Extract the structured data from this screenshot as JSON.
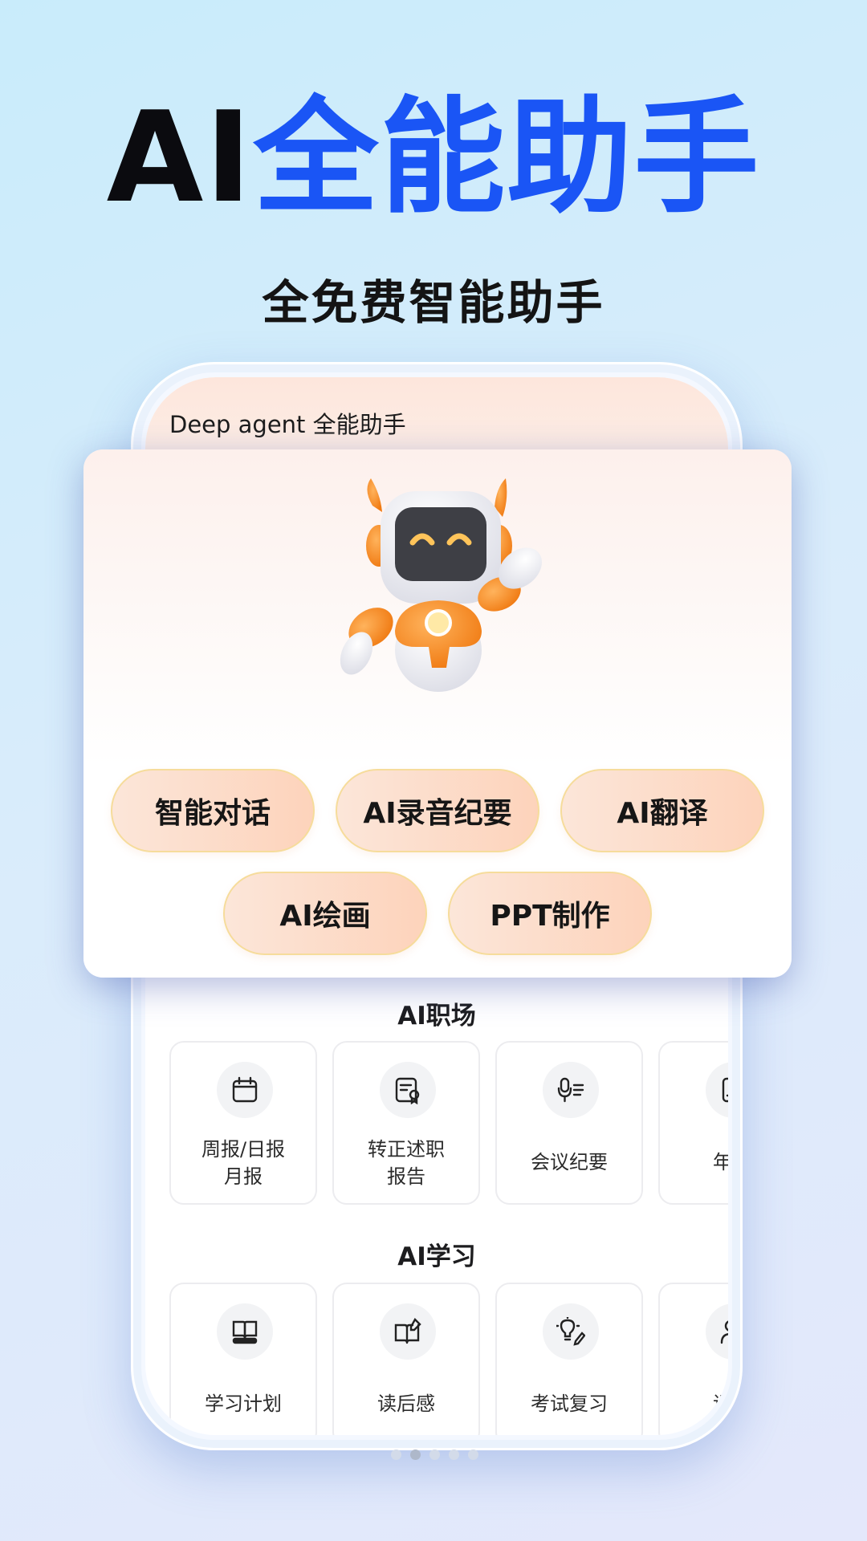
{
  "hero": {
    "title_prefix": "AI",
    "title_main": "全能助手",
    "subtitle": "全免费智能助手"
  },
  "app": {
    "title": "Deep agent 全能助手"
  },
  "features": {
    "row1": [
      "智能对话",
      "AI录音纪要",
      "AI翻译"
    ],
    "row2": [
      "AI绘画",
      "PPT制作"
    ]
  },
  "sections": {
    "workplace": {
      "title": "AI职场",
      "items": [
        {
          "label": "周报/日报\n月报",
          "icon": "calendar-icon"
        },
        {
          "label": "转正述职\n报告",
          "icon": "certificate-icon"
        },
        {
          "label": "会议纪要",
          "icon": "microphone-notes-icon"
        },
        {
          "label": "年终",
          "icon": "document-icon"
        }
      ]
    },
    "study": {
      "title": "AI学习",
      "items": [
        {
          "label": "学习计划",
          "icon": "book-icon"
        },
        {
          "label": "读后感",
          "icon": "book-pen-icon"
        },
        {
          "label": "考试复习",
          "icon": "lightbulb-icon"
        },
        {
          "label": "课堂",
          "icon": "person-icon"
        }
      ]
    }
  },
  "colors": {
    "accent_blue": "#1a55f5",
    "pill_border": "#f6dc9b",
    "pill_fill": "#fdd3bb"
  },
  "pagination": {
    "count": 5,
    "active_index": 1
  }
}
